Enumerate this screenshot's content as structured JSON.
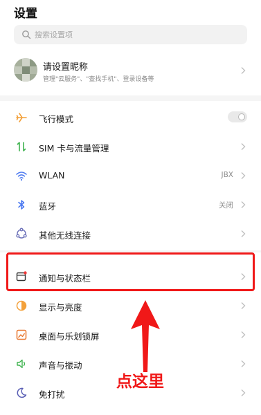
{
  "header": {
    "title": "设置"
  },
  "search": {
    "placeholder": "搜索设置项",
    "icon": "search-icon"
  },
  "account": {
    "name": "请设置昵称",
    "subtitle": "管理\"云服务\"、\"查找手机\"、登录设备等"
  },
  "items": [
    {
      "key": "airplane",
      "label": "飞行模式",
      "icon": "airplane-icon",
      "control": "toggle",
      "toggle_on": false
    },
    {
      "key": "sim",
      "label": "SIM 卡与流量管理",
      "icon": "sim-data-icon"
    },
    {
      "key": "wlan",
      "label": "WLAN",
      "icon": "wifi-icon",
      "value": "JBX"
    },
    {
      "key": "bluetooth",
      "label": "蓝牙",
      "icon": "bluetooth-icon",
      "value": "关闭"
    },
    {
      "key": "wireless",
      "label": "其他无线连接",
      "icon": "wireless-connection-icon"
    },
    {
      "key": "notify",
      "label": "通知与状态栏",
      "icon": "notification-icon"
    },
    {
      "key": "display",
      "label": "显示与亮度",
      "icon": "brightness-icon"
    },
    {
      "key": "desktop",
      "label": "桌面与乐划锁屏",
      "icon": "wallpaper-icon"
    },
    {
      "key": "sound",
      "label": "声音与振动",
      "icon": "speaker-icon"
    },
    {
      "key": "dnd",
      "label": "免打扰",
      "icon": "moon-icon"
    }
  ],
  "annotation": {
    "text": "点这里",
    "color": "#f01818"
  },
  "colors": {
    "accent_orange": "#f3a13b",
    "accent_green": "#3fb34f",
    "accent_blue": "#4a78f0",
    "highlight_red": "#f01818"
  }
}
